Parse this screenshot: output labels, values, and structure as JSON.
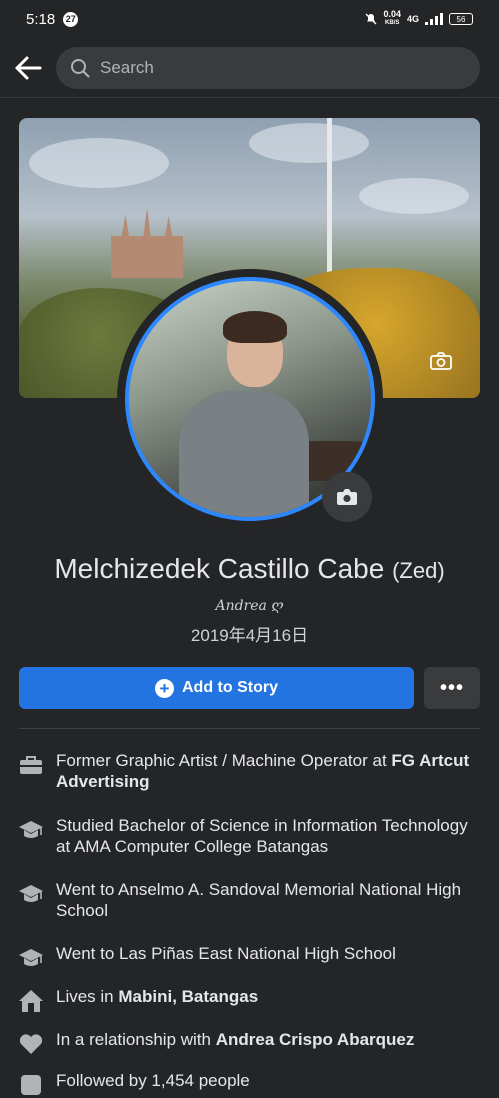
{
  "status_bar": {
    "time": "5:18",
    "notification_count": "27",
    "net_speed": "0.04",
    "net_unit": "KB/S",
    "signal_label": "4G",
    "battery": "56"
  },
  "top_bar": {
    "search_placeholder": "Search"
  },
  "profile": {
    "name": "Melchizedek Castillo Cabe",
    "nickname": "(Zed)",
    "bio_signature": "Andrea ღ",
    "bio_date": "2019年4月16日"
  },
  "actions": {
    "add_story_label": "Add to Story",
    "more_label": "•••"
  },
  "details": [
    {
      "icon": "briefcase-icon",
      "text": "Former Graphic Artist / Machine Operator at ",
      "bold": "FG Artcut Advertising"
    },
    {
      "icon": "graduation-cap-icon",
      "text": "Studied Bachelor of Science in Information Technology at AMA Computer College Batangas",
      "bold": ""
    },
    {
      "icon": "graduation-cap-icon",
      "text": "Went to Anselmo A. Sandoval Memorial National High School",
      "bold": ""
    },
    {
      "icon": "graduation-cap-icon",
      "text": "Went to Las Piñas East National High School",
      "bold": ""
    },
    {
      "icon": "home-icon",
      "text": "Lives in ",
      "bold": "Mabini, Batangas"
    },
    {
      "icon": "heart-icon",
      "text": "In a relationship with ",
      "bold": "Andrea Crispo Abarquez"
    },
    {
      "icon": "followers-icon",
      "text": "Followed by 1,454 people",
      "bold": ""
    }
  ]
}
